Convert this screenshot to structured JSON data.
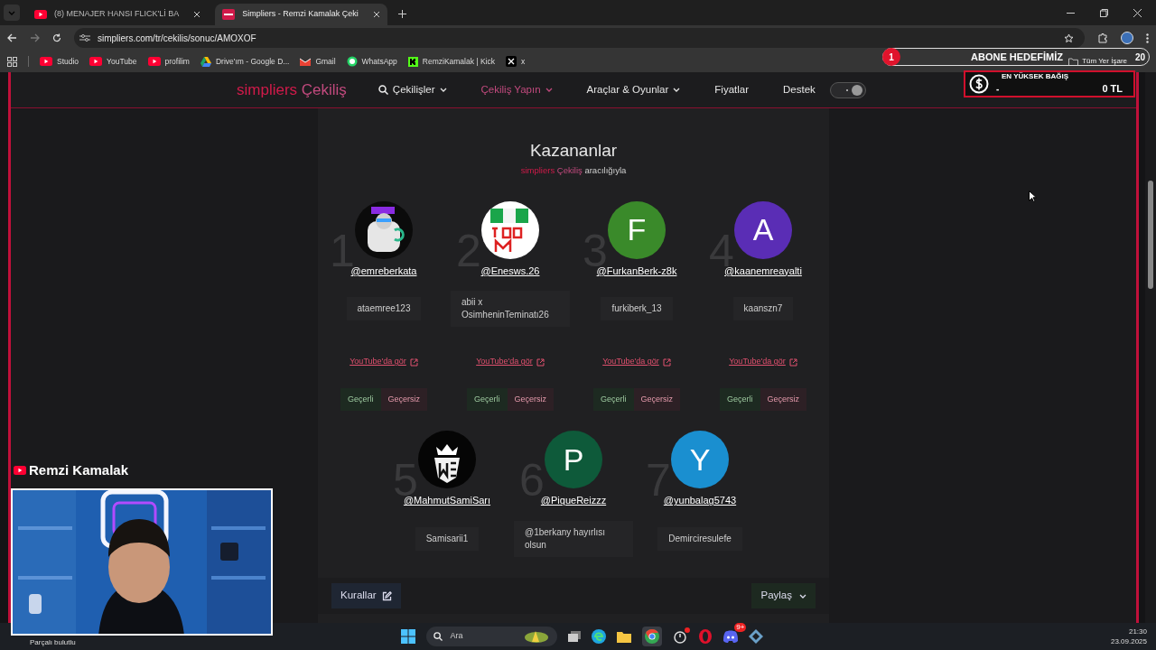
{
  "browser": {
    "tabs": [
      {
        "title": "(8) MENAJER HANSI FLICK'Lİ BA",
        "kind": "youtube",
        "selected": false
      },
      {
        "title": "Simpliers - Remzi Kamalak Çeki",
        "kind": "simpliers",
        "selected": true
      }
    ],
    "url": "simpliers.com/tr/cekilis/sonuc/AMOXOF",
    "bookmarks": [
      {
        "label": "Studio",
        "kind": "youtube"
      },
      {
        "label": "YouTube",
        "kind": "youtube"
      },
      {
        "label": "profilim",
        "kind": "youtube"
      },
      {
        "label": "Drive'ım - Google D...",
        "kind": "drive"
      },
      {
        "label": "Gmail",
        "kind": "gmail"
      },
      {
        "label": "WhatsApp",
        "kind": "whatsapp"
      },
      {
        "label": "RemziKamalak | Kick",
        "kind": "kick"
      },
      {
        "label": "x",
        "kind": "x"
      }
    ],
    "all_bookmarks": "Tüm Yer İşare"
  },
  "subscriber_goal": {
    "current": "1",
    "label": "ABONE HEDEFİMİZ",
    "target": "20"
  },
  "top_donation": {
    "label": "EN YÜKSEK BAĞIŞ",
    "name": "-",
    "amount": "0 TL"
  },
  "site": {
    "logo_brand": "simpliers",
    "logo_product": "Çekiliş",
    "nav": [
      {
        "label": "Çekilişler",
        "search_icon": true,
        "has_menu": true,
        "selected": false
      },
      {
        "label": "Çekiliş Yapın",
        "search_icon": false,
        "has_menu": true,
        "selected": true
      },
      {
        "label": "Araçlar & Oyunlar",
        "search_icon": false,
        "has_menu": true,
        "selected": false
      },
      {
        "label": "Fiyatlar",
        "search_icon": false,
        "has_menu": false,
        "selected": false
      },
      {
        "label": "Destek",
        "search_icon": false,
        "has_menu": false,
        "selected": false
      }
    ],
    "theme_toggle": true
  },
  "results": {
    "title": "Kazananlar",
    "subtitle_brand": "simpliers",
    "subtitle_product": "Çekiliş",
    "subtitle_rest": "aracılığıyla",
    "winners": [
      {
        "rank": "1",
        "handle": "@emreberkata",
        "comment": "ataemree123",
        "link": "YouTube'da gör",
        "valid": "Geçerli",
        "invalid": "Geçersiz"
      },
      {
        "rank": "2",
        "handle": "@Enesws.26",
        "comment": "abii x OsimheninTeminatı26",
        "link": "YouTube'da gör",
        "valid": "Geçerli",
        "invalid": "Geçersiz"
      },
      {
        "rank": "3",
        "avatar": {
          "kind": "letter",
          "letter": "F",
          "color": "#3a8a2a"
        },
        "handle": "@FurkanBerk-z8k",
        "comment": "furkiberk_13",
        "link": "YouTube'da gör",
        "valid": "Geçerli",
        "invalid": "Geçersiz"
      },
      {
        "rank": "4",
        "avatar": {
          "kind": "letter",
          "letter": "A",
          "color": "#5a2db5"
        },
        "handle": "@kaanemreayalti",
        "comment": "kaanszn7",
        "link": "YouTube'da gör",
        "valid": "Geçerli",
        "invalid": "Geçersiz"
      },
      {
        "rank": "5",
        "handle": "@MahmutSamiSarı",
        "comment": "Samisarii1"
      },
      {
        "rank": "6",
        "avatar": {
          "kind": "letter",
          "letter": "P",
          "color": "#0e5a3a"
        },
        "handle": "@PiqueReizzz",
        "comment": "@1berkany hayırlısı olsun"
      },
      {
        "rank": "7",
        "avatar": {
          "kind": "letter",
          "letter": "Y",
          "color": "#1a8fd0"
        },
        "handle": "@yunbalag5743",
        "comment": "Demirciresulefe"
      }
    ],
    "rules_button": "Kurallar",
    "share_button": "Paylaş"
  },
  "stream": {
    "channel": "Remzi Kamalak"
  },
  "taskbar": {
    "weather": "Parçalı bulutlu",
    "search_placeholder": "Ara",
    "discord_badge": "9+",
    "time": "21:30",
    "date": "23.09.2025"
  }
}
